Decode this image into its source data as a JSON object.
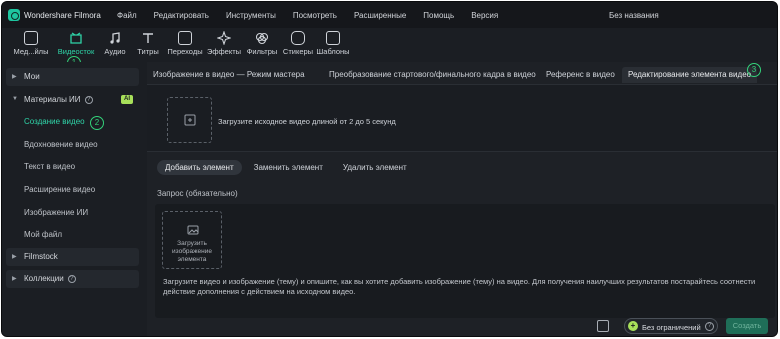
{
  "app": {
    "name": "Wondershare Filmora",
    "document_title": "Без названия"
  },
  "menu": [
    "Файл",
    "Редактировать",
    "Инструменты",
    "Посмотреть",
    "Расширенные",
    "Помощь",
    "Версия"
  ],
  "toolbar": {
    "items": [
      {
        "label": "Мед...йлы",
        "icon": "media-icon"
      },
      {
        "label": "Видеосток",
        "icon": "stock-video-icon"
      },
      {
        "label": "Аудио",
        "icon": "music-note-icon"
      },
      {
        "label": "Титры",
        "icon": "text-icon"
      },
      {
        "label": "Переходы",
        "icon": "transition-icon"
      },
      {
        "label": "Эффекты",
        "icon": "sparkle-icon"
      },
      {
        "label": "Фильтры",
        "icon": "filter-icon"
      },
      {
        "label": "Стикеры",
        "icon": "sticker-icon"
      },
      {
        "label": "Шаблоны",
        "icon": "template-icon"
      }
    ],
    "active_index": 1
  },
  "annotations": [
    "1",
    "2",
    "3"
  ],
  "sidebar": {
    "mine": "Мои",
    "ai_materials": "Материалы ИИ",
    "ai_badge": "AI",
    "items": [
      "Создание видео",
      "Вдохновение видео",
      "Текст в видео",
      "Расширение видео",
      "Изображение ИИ",
      "Мой файл"
    ],
    "filmstock": "Filmstock",
    "collections": "Коллекции"
  },
  "tabs": [
    "Изображение в видео — Режим мастера",
    "Преобразование стартового/финального кадра в видео",
    "Референс в видео",
    "Редактирование элемента видео"
  ],
  "upload": {
    "hint": "Загрузите исходное видео длиной от 2 до 5 секунд"
  },
  "subtabs": [
    "Добавить элемент",
    "Заменить элемент",
    "Удалить элемент"
  ],
  "prompt": {
    "label": "Запрос (обязательно)",
    "image_slot_line1": "Загрузить",
    "image_slot_line2": "изображение",
    "image_slot_line3": "элемента",
    "description": "Загрузите видео и изображение (тему) и опишите, как вы хотите добавить изображение (тему) на видео. Для получения наилучших результатов постарайтесь соотнести действие дополнения с действием на исходном видео."
  },
  "footer": {
    "plan_label": "Без ограничений",
    "create_label": "Создать"
  },
  "colors": {
    "accent": "#2fd4a8",
    "annotation": "#33d27a",
    "badge": "#a8e05a",
    "bg": "#1b1e23"
  }
}
